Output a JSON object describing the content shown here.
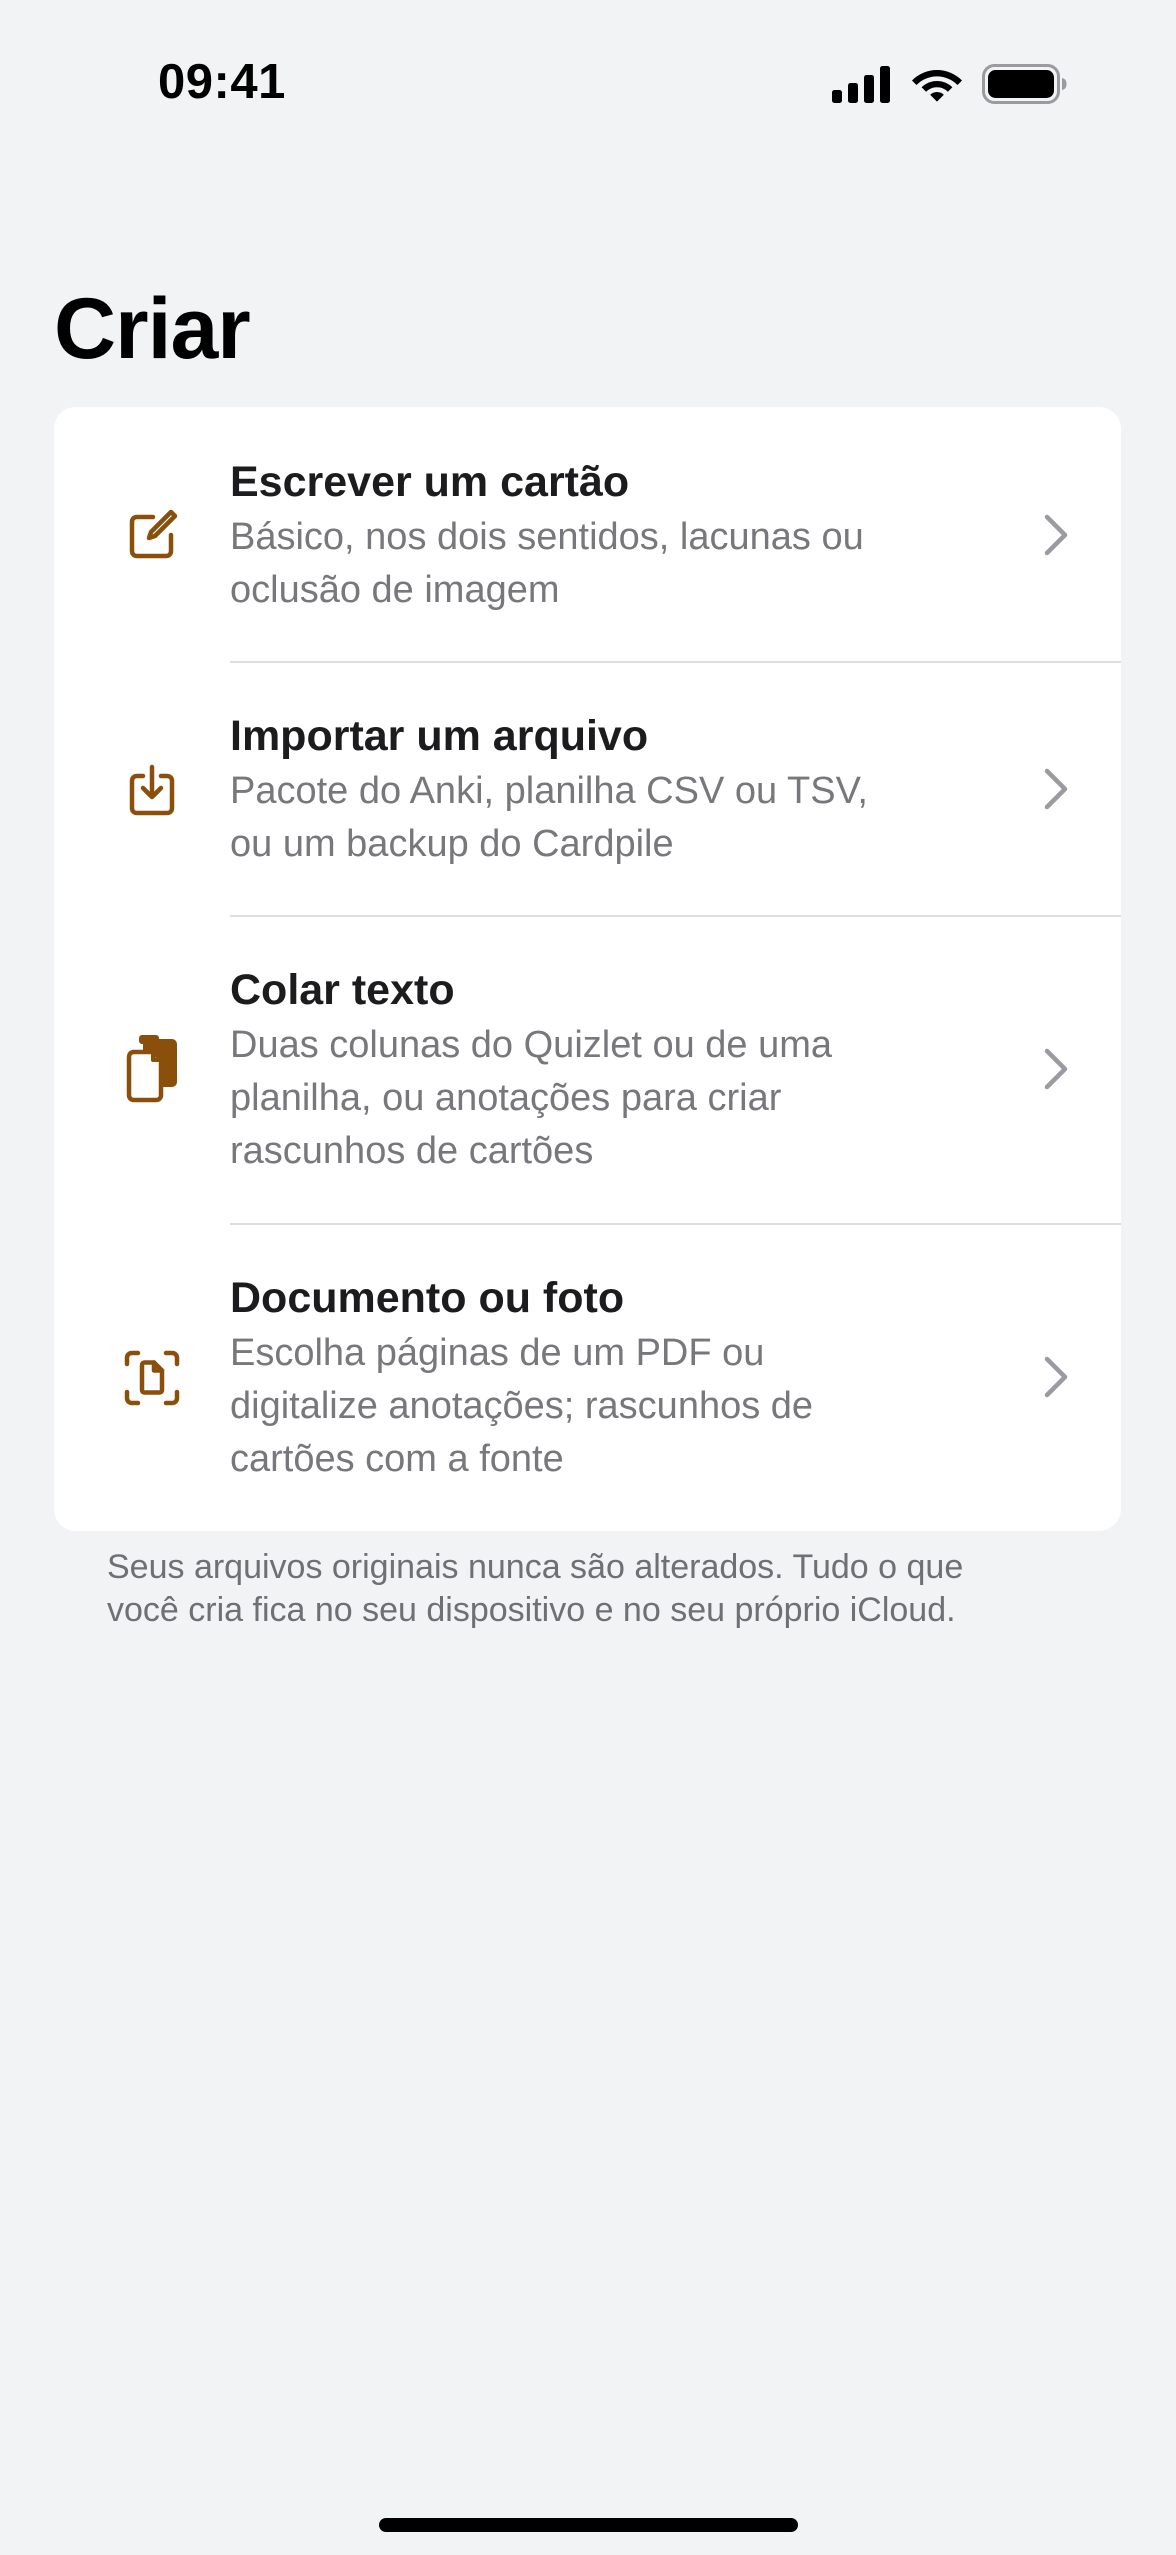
{
  "status_bar": {
    "time": "09:41",
    "icons": [
      "cellular-signal-icon",
      "wifi-icon",
      "battery-icon"
    ]
  },
  "page": {
    "title": "Criar"
  },
  "options": [
    {
      "icon": "compose-icon",
      "title": "Escrever um cartão",
      "subtitle_lines": [
        "Básico, nos dois sentidos, lacunas ou",
        "oclusão de imagem"
      ]
    },
    {
      "icon": "import-tray-icon",
      "title": "Importar um arquivo",
      "subtitle_lines": [
        "Pacote do Anki, planilha CSV ou TSV,",
        "ou um backup do Cardpile"
      ]
    },
    {
      "icon": "paste-document-icon",
      "title": "Colar texto",
      "subtitle_lines": [
        "Duas colunas do Quizlet ou de uma",
        "planilha, ou anotações para criar",
        "rascunhos de cartões"
      ]
    },
    {
      "icon": "document-scan-icon",
      "title": "Documento ou foto",
      "subtitle_lines": [
        "Escolha páginas de um PDF ou",
        "digitalize anotações; rascunhos de",
        "cartões com a fonte"
      ]
    }
  ],
  "footer": {
    "lines": [
      "Seus arquivos originais nunca são alterados. Tudo o que",
      "você cria fica no seu dispositivo e no seu próprio iCloud."
    ]
  },
  "colors": {
    "accent": "#8a4f0b",
    "background": "#f2f3f5",
    "card": "#ffffff",
    "secondary_text": "#77777c",
    "chevron": "#9a9aa0"
  }
}
